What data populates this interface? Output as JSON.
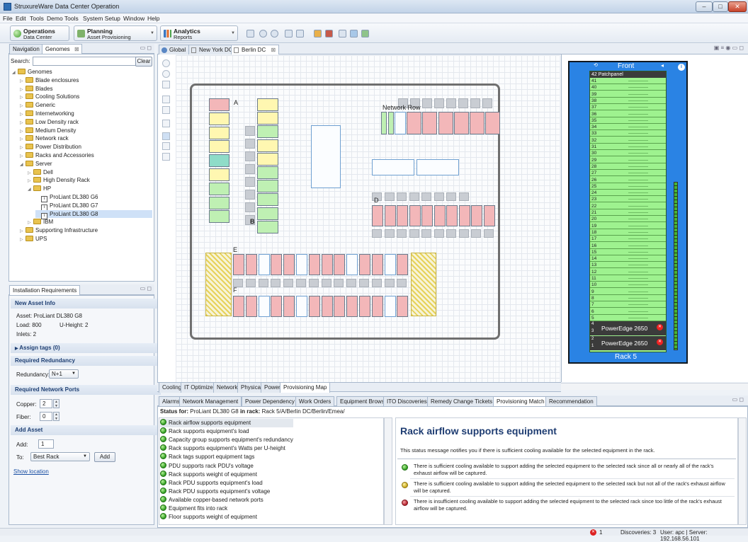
{
  "window": {
    "title": "StruxureWare Data Center Operation",
    "min": "–",
    "max": "□",
    "close": "✕"
  },
  "menu": [
    "File",
    "Edit",
    "Tools",
    "Demo Tools",
    "System Setup",
    "Window",
    "Help"
  ],
  "toolbar": {
    "perspectives": [
      {
        "title": "Operations",
        "sub": "Data Center"
      },
      {
        "title": "Planning",
        "sub": "Asset Provisioning"
      },
      {
        "title": "Analytics",
        "sub": "Reports"
      }
    ]
  },
  "left_panel": {
    "tabs": [
      "Navigation",
      "Genomes"
    ],
    "search_label": "Search:",
    "search_value": "",
    "clear_label": "Clear",
    "tree": [
      {
        "label": "Genomes",
        "kind": "folder",
        "level": 0,
        "open": true
      },
      {
        "label": "Blade enclosures",
        "kind": "folder",
        "level": 1
      },
      {
        "label": "Blades",
        "kind": "folder",
        "level": 1
      },
      {
        "label": "Cooling Solutions",
        "kind": "folder",
        "level": 1
      },
      {
        "label": "Generic",
        "kind": "folder",
        "level": 1
      },
      {
        "label": "Internetworking",
        "kind": "folder",
        "level": 1
      },
      {
        "label": "Low Density rack",
        "kind": "folder",
        "level": 1
      },
      {
        "label": "Medium Density",
        "kind": "folder",
        "level": 1
      },
      {
        "label": "Network rack",
        "kind": "folder",
        "level": 1
      },
      {
        "label": "Power Distribution",
        "kind": "folder",
        "level": 1
      },
      {
        "label": "Racks and Accessories",
        "kind": "folder",
        "level": 1
      },
      {
        "label": "Server",
        "kind": "folder",
        "level": 1,
        "open": true
      },
      {
        "label": "Dell",
        "kind": "folder",
        "level": 2
      },
      {
        "label": "High Density Rack",
        "kind": "folder",
        "level": 2
      },
      {
        "label": "HP",
        "kind": "folder",
        "level": 2,
        "open": true
      },
      {
        "label": "ProLiant DL380 G6",
        "kind": "item",
        "level": 3
      },
      {
        "label": "ProLiant DL380 G7",
        "kind": "item",
        "level": 3
      },
      {
        "label": "ProLiant DL380 G8",
        "kind": "item",
        "level": 3,
        "selected": true
      },
      {
        "label": "IBM",
        "kind": "folder",
        "level": 2
      },
      {
        "label": "Supporting Infrastructure",
        "kind": "folder",
        "level": 1
      },
      {
        "label": "UPS",
        "kind": "folder",
        "level": 1
      }
    ]
  },
  "install": {
    "tab": "Installation Requirements",
    "new_asset_header": "New Asset Info",
    "asset": "Asset: ProLiant DL380 G8",
    "load": "Load: 800",
    "uheight": "U-Height: 2",
    "inlets": "Inlets: 2",
    "assign_tags": "Assign tags (0)",
    "redundancy_header": "Required Redundancy",
    "redundancy_label": "Redundancy:",
    "redundancy_value": "N+1",
    "ports_header": "Required Network Ports",
    "copper_label": "Copper:",
    "copper_value": "2",
    "fiber_label": "Fiber:",
    "fiber_value": "0",
    "add_asset_header": "Add Asset",
    "add_label": "Add:",
    "add_value": "1",
    "to_label": "To:",
    "to_value": "Best Rack",
    "add_button": "Add",
    "show_location": "Show location"
  },
  "editor_tabs": [
    "Global",
    "New York DC",
    "Berlin DC"
  ],
  "map": {
    "labels": {
      "a": "A",
      "b": "B",
      "d": "D",
      "e": "E",
      "f": "F",
      "network_row": "Network Row"
    }
  },
  "bottom_map_tabs": [
    "Cooling",
    "IT Optimize",
    "Network",
    "Physical",
    "Power",
    "Provisioning Map"
  ],
  "rack_view": {
    "title": "Front",
    "rack_name": "Rack 5",
    "patchpanel": "Patchpanel",
    "top_u": "42",
    "units": [
      "41",
      "40",
      "39",
      "38",
      "37",
      "36",
      "35",
      "34",
      "33",
      "32",
      "31",
      "30",
      "29",
      "28",
      "27",
      "26",
      "25",
      "24",
      "23",
      "22",
      "21",
      "20",
      "19",
      "18",
      "17",
      "16",
      "15",
      "14",
      "13",
      "12",
      "11",
      "10",
      "9",
      "8",
      "7",
      "6",
      "5"
    ],
    "devices": [
      {
        "u_top": "4",
        "u_bottom": "3",
        "name": "PowerEdge 2650"
      },
      {
        "u_top": "2",
        "u_bottom": "1",
        "name": "PowerEdge 2650"
      }
    ]
  },
  "bottom_tabs": [
    "Alarms",
    "Network Management",
    "Power Dependency",
    "Work Orders",
    "Equipment Browser",
    "ITO Discoveries",
    "Remedy Change Tickets",
    "Provisioning Match",
    "Recommendation"
  ],
  "status_line": {
    "prefix": "Status for: ",
    "asset": "ProLiant DL380 G8",
    "mid": " in rack: ",
    "rack": "Rack 5/A/Berlin DC/Berlin/Emea/"
  },
  "checks": [
    "Rack airflow supports equipment",
    "Rack supports equipment's load",
    "Capacity group supports equipment's redundancy",
    "Rack supports equipment's Watts per U-height",
    "Rack tags support equipment tags",
    "PDU supports rack PDU's voltage",
    "Rack supports weight of equipment",
    "Rack PDU supports equipment's load",
    "Rack PDU supports equipment's voltage",
    "Available copper-based network ports",
    "Equipment fits into rack",
    "Floor supports weight of equipment"
  ],
  "detail": {
    "title": "Rack airflow supports equipment",
    "desc": "This status message notifies you if there is sufficient cooling available for the selected equipment in the rack.",
    "items": [
      {
        "color": "g",
        "text": "There is sufficient cooling available to support adding the selected equipment to the selected rack since all or nearly all of the rack's exhaust airflow will be captured."
      },
      {
        "color": "y",
        "text": "There is sufficient cooling available to support adding the selected equipment to the selected rack but not all of the rack's exhaust airflow will be captured."
      },
      {
        "color": "r",
        "text": "There is insufficient cooling available to support adding the selected equipment to the selected rack since too little of the rack's exhaust airflow will be captured."
      }
    ]
  },
  "statusbar": {
    "alarm_count": "1",
    "discoveries": "Discoveries: 3",
    "user": "User: apc | Server: 192.168.56.101"
  }
}
